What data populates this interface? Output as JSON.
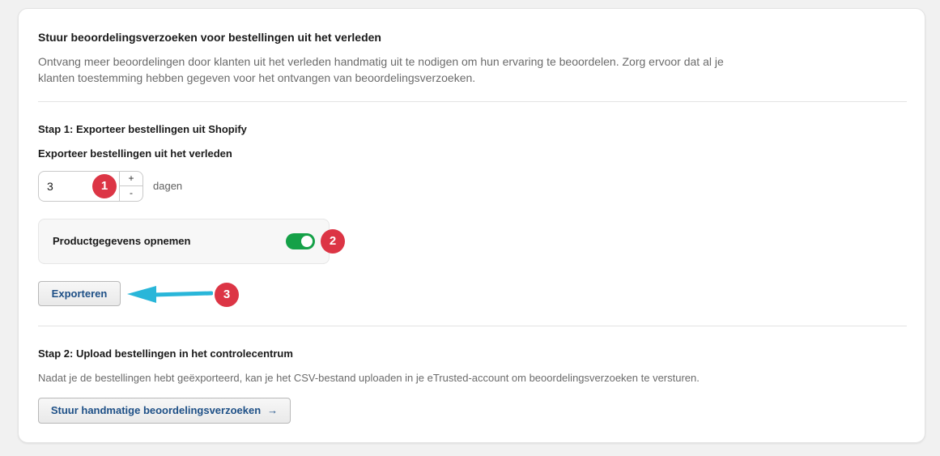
{
  "section": {
    "title": "Stuur beoordelingsverzoeken voor bestellingen uit het verleden",
    "description": "Ontvang meer beoordelingen door klanten uit het verleden handmatig uit te nodigen om hun ervaring te beoordelen. Zorg ervoor dat al je klanten toestemming hebben gegeven voor het ontvangen van beoordelingsverzoeken."
  },
  "step1": {
    "title": "Stap 1: Exporteer bestellingen uit Shopify",
    "field_label": "Exporteer bestellingen uit het verleden",
    "days_value": "3",
    "stepper_up": "+",
    "stepper_down": "-",
    "days_suffix": "dagen",
    "toggle_label": "Productgegevens opnemen",
    "toggle_on": true,
    "export_button": "Exporteren"
  },
  "step2": {
    "title": "Stap 2: Upload bestellingen in het controlecentrum",
    "description": "Nadat je de bestellingen hebt geëxporteerd, kan je het CSV-bestand uploaden in je eTrusted-account om beoordelingsverzoeken te versturen.",
    "send_button": "Stuur handmatige beoordelingsverzoeken",
    "send_button_icon": "→"
  },
  "annotations": {
    "badge1": "1",
    "badge2": "2",
    "badge3": "3"
  },
  "colors": {
    "badge": "#dc3545",
    "toggle_on": "#15a148",
    "arrow": "#29b6d9",
    "link_text": "#1d4f86"
  }
}
